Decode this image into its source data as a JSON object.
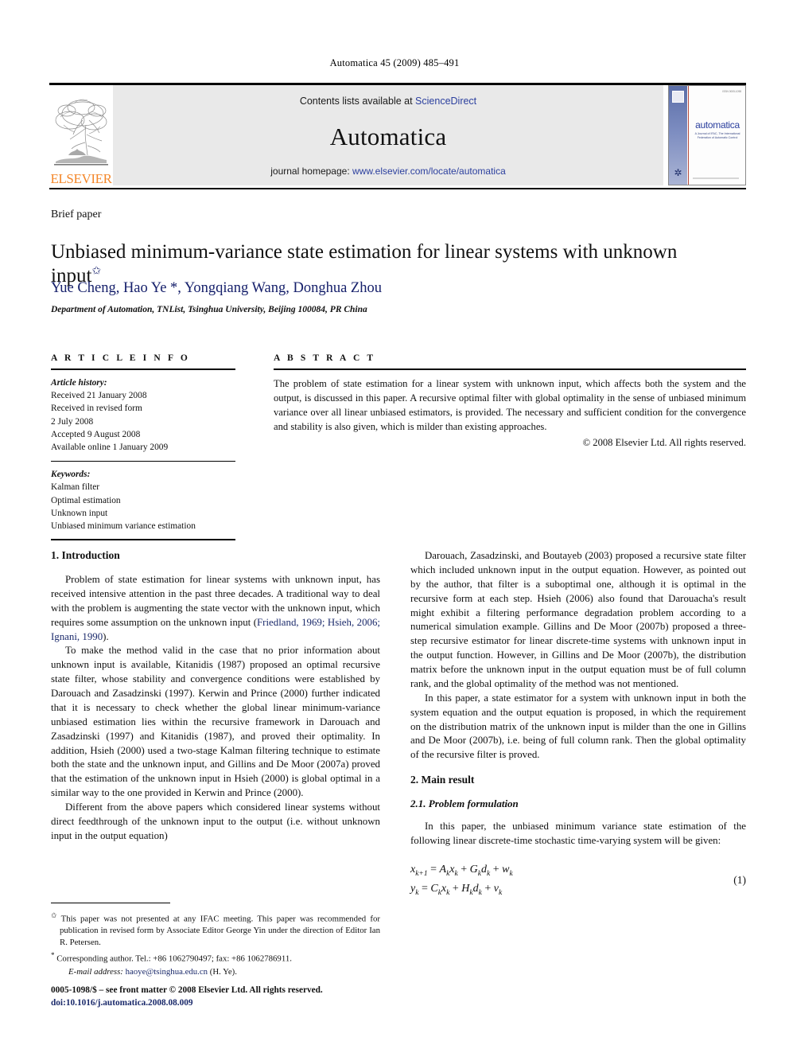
{
  "running_head": "Automatica 45 (2009) 485–491",
  "banner": {
    "publisher": "ELSEVIER",
    "contents_prefix": "Contents lists available at ",
    "contents_link": "ScienceDirect",
    "journal": "Automatica",
    "homepage_prefix": "journal homepage: ",
    "homepage_url": "www.elsevier.com/locate/automatica",
    "cover": {
      "title": "automatica",
      "subtitle": "A Journal of IFAC, The International Federation of Automatic Control",
      "top_code": "ISSN 0005-1098"
    }
  },
  "article": {
    "type": "Brief paper",
    "title": "Unbiased minimum-variance state estimation for linear systems with unknown input",
    "title_footnote_mark": "✩",
    "authors": "Yue Cheng, Hao Ye *, Yongqiang Wang, Donghua Zhou",
    "affiliation": "Department of Automation, TNList, Tsinghua University, Beijing 100084, PR China"
  },
  "info": {
    "heading": "A R T I C L E    I N F O",
    "history_label": "Article history:",
    "history": [
      "Received 21 January 2008",
      "Received in revised form",
      "2 July 2008",
      "Accepted 9 August 2008",
      "Available online 1 January 2009"
    ],
    "keywords_label": "Keywords:",
    "keywords": [
      "Kalman filter",
      "Optimal estimation",
      "Unknown input",
      "Unbiased minimum variance estimation"
    ]
  },
  "abstract": {
    "heading": "A B S T R A C T",
    "text": "The problem of state estimation for a linear system with unknown input, which affects both the system and the output, is discussed in this paper. A recursive optimal filter with global optimality in the sense of unbiased minimum variance over all linear unbiased estimators, is provided. The necessary and sufficient condition for the convergence and stability is also given, which is milder than existing approaches.",
    "copyright": "© 2008 Elsevier Ltd. All rights reserved."
  },
  "sections": {
    "introduction_heading": "1. Introduction",
    "main_result_heading": "2. Main result",
    "problem_formulation_heading": "2.1. Problem formulation"
  },
  "body": {
    "left_p1_a": "Problem of state estimation for linear systems with unknown input, has received intensive attention in the past three decades. A traditional way to deal with the problem is augmenting the state vector with the unknown input, which requires some assumption on the unknown input (",
    "left_p1_cite": "Friedland, 1969; Hsieh, 2006; Ignani, 1990",
    "left_p1_b": ").",
    "left_p2": "To make the method valid in the case that no prior information about unknown input is available, Kitanidis (1987) proposed an optimal recursive state filter, whose stability and convergence conditions were established by Darouach and Zasadzinski (1997). Kerwin and Prince (2000) further indicated that it is necessary to check whether the global linear minimum-variance unbiased estimation lies within the recursive framework in Darouach and Zasadzinski (1997) and Kitanidis (1987), and proved their optimality. In addition, Hsieh (2000) used a two-stage Kalman filtering technique to estimate both the state and the unknown input, and Gillins and De Moor (2007a) proved that the estimation of the unknown input in Hsieh (2000) is global optimal in a similar way to the one provided in Kerwin and Prince (2000).",
    "left_p3": "Different from the above papers which considered linear systems without direct feedthrough of the unknown input to the output (i.e. without unknown input in the output equation)",
    "right_p1": "Darouach, Zasadzinski, and Boutayeb (2003) proposed a recursive state filter which included unknown input in the output equation. However, as pointed out by the author, that filter is a suboptimal one, although it is optimal in the recursive form at each step. Hsieh (2006) also found that Darouacha's result might exhibit a filtering performance degradation problem according to a numerical simulation example. Gillins and De Moor (2007b) proposed a three-step recursive estimator for linear discrete-time systems with unknown input in the output function. However, in Gillins and De Moor (2007b), the distribution matrix before the unknown input in the output equation must be of full column rank, and the global optimality of the method was not mentioned.",
    "right_p2": "In this paper, a state estimator for a system with unknown input in both the system equation and the output equation is proposed, in which the requirement on the distribution matrix of the unknown input is milder than the one in Gillins and De Moor (2007b), i.e. being of full column rank. Then the global optimality of the recursive filter is proved.",
    "right_p3": "In this paper, the unbiased minimum variance state estimation of the following linear discrete-time stochastic time-varying system will be given:"
  },
  "equation": {
    "line1": "x_{k+1} = A_k x_k + G_k d_k + w_k",
    "line2": "y_k = C_k x_k + H_k d_k + v_k",
    "number": "(1)"
  },
  "footnotes": {
    "star_mark": "✩",
    "star_text": "This paper was not presented at any IFAC meeting. This paper was recommended for publication in revised form by Associate Editor George Yin under the direction of Editor Ian R. Petersen.",
    "corr_mark": "*",
    "corr_text": "Corresponding author. Tel.: +86 1062790497; fax: +86 1062786911.",
    "email_label": "E-mail address:",
    "email": "haoye@tsinghua.edu.cn",
    "email_suffix": "(H. Ye)."
  },
  "imprint": {
    "line1": "0005-1098/$ – see front matter © 2008 Elsevier Ltd. All rights reserved.",
    "doi": "doi:10.1016/j.automatica.2008.08.009"
  },
  "colors": {
    "link_blue": "#2b3f9e",
    "cite_blue": "#1b2a6b",
    "elsevier_orange": "#f4872a",
    "banner_gray": "#e9e9e9"
  }
}
